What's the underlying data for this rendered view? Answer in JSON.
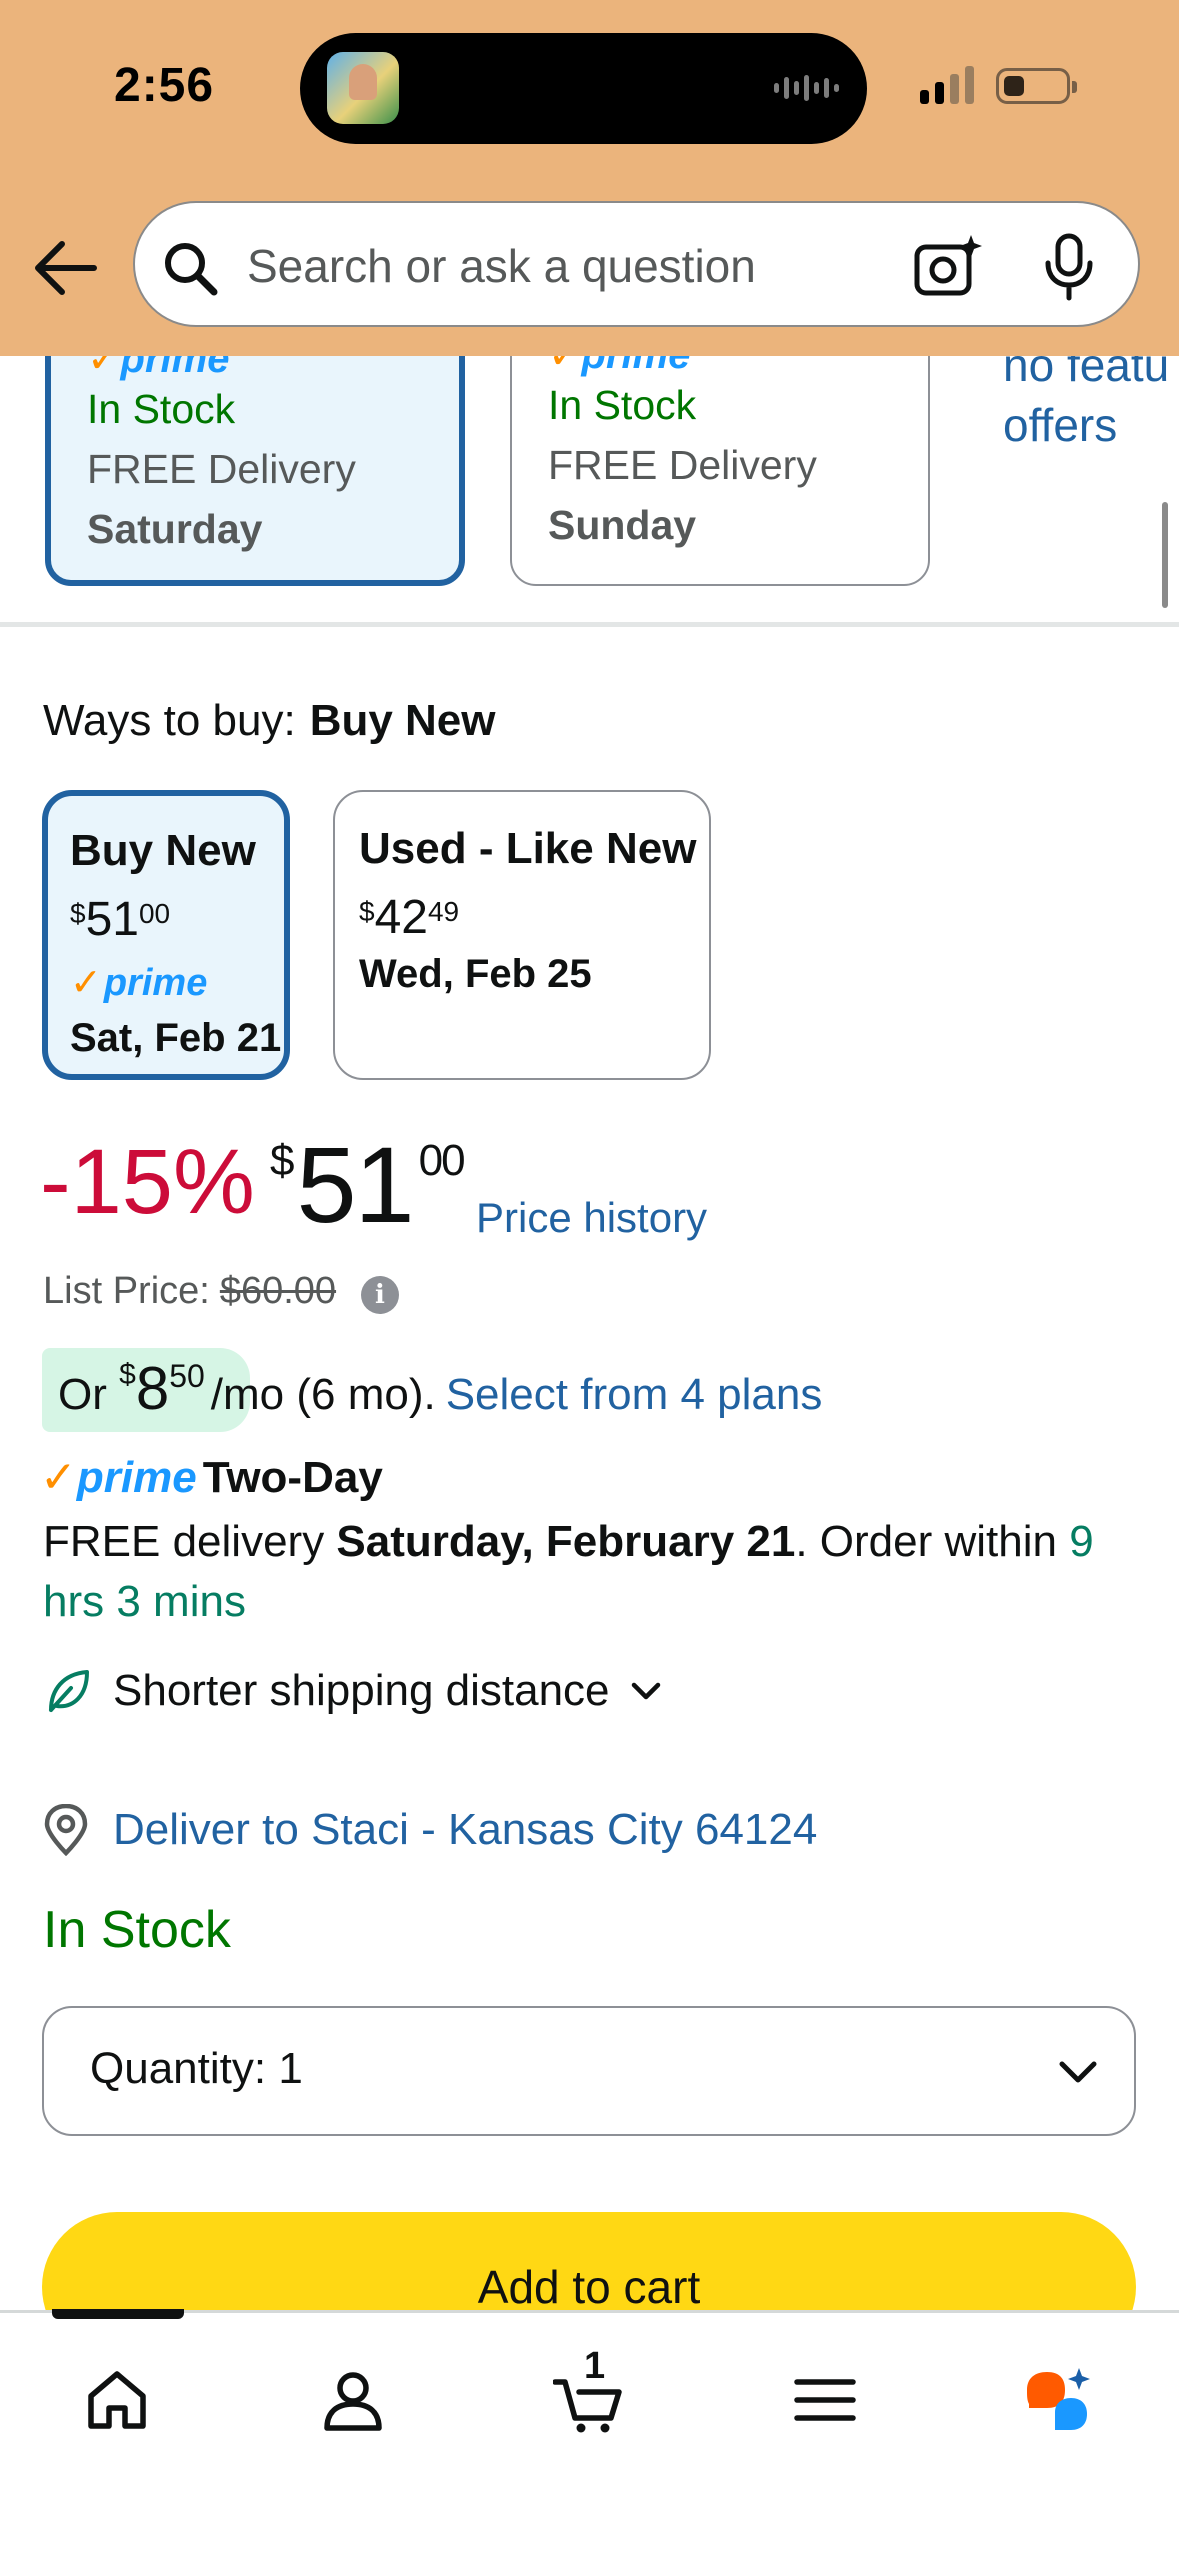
{
  "status_bar": {
    "time": "2:56"
  },
  "search": {
    "placeholder": "Search or ask a question"
  },
  "delivery_options": [
    {
      "stock": "In Stock",
      "delivery": "FREE Delivery",
      "day": "Saturday",
      "prime_fragment": "prime",
      "selected": true
    },
    {
      "stock": "In Stock",
      "delivery": "FREE Delivery",
      "day": "Sunday",
      "prime_fragment": "prime",
      "selected": false
    }
  ],
  "no_featured": {
    "line1": "no featu",
    "line2": "offers"
  },
  "ways_to_buy": {
    "label": "Ways to buy:",
    "selected": "Buy New",
    "options": [
      {
        "title": "Buy New",
        "price_dollar_sign": "$",
        "price_whole": "51",
        "price_cents": "00",
        "prime": "prime",
        "date": "Sat, Feb 21"
      },
      {
        "title": "Used - Like New",
        "price_dollar_sign": "$",
        "price_whole": "42",
        "price_cents": "49",
        "date": "Wed, Feb 25"
      }
    ]
  },
  "price": {
    "discount": "-15%",
    "currency": "$",
    "whole": "51",
    "cents": "00",
    "history_link": "Price history",
    "list_price_label": "List Price:",
    "list_price_value": "$60.00"
  },
  "installment": {
    "prefix": "Or",
    "currency": "$",
    "amount": "8",
    "cents": "50",
    "term": "/mo (6 mo).",
    "link": "Select from 4 plans"
  },
  "prime_delivery": {
    "logo": "prime",
    "speed": "Two-Day",
    "text_before": "FREE delivery ",
    "date": "Saturday, February 21",
    "text_after": ". Order within ",
    "countdown": "9 hrs 3 mins"
  },
  "shipping": {
    "label": "Shorter shipping distance"
  },
  "deliver_to": {
    "label": "Deliver to Staci - Kansas City 64124"
  },
  "stock_status": "In Stock",
  "quantity": {
    "label": "Quantity:",
    "value": "1"
  },
  "add_to_cart": {
    "label": "Add to cart"
  },
  "tabbar": {
    "cart_count": "1",
    "icons": [
      "home-icon",
      "account-icon",
      "cart-icon",
      "menu-icon",
      "rufus-icon"
    ]
  },
  "colors": {
    "header": "#ebb47c",
    "link": "#2162a1",
    "discount": "#cc0c39",
    "in_stock": "#007600",
    "add_to_cart": "#ffd814",
    "prime_blue": "#1a98ff",
    "prime_check": "#ff8f00"
  }
}
